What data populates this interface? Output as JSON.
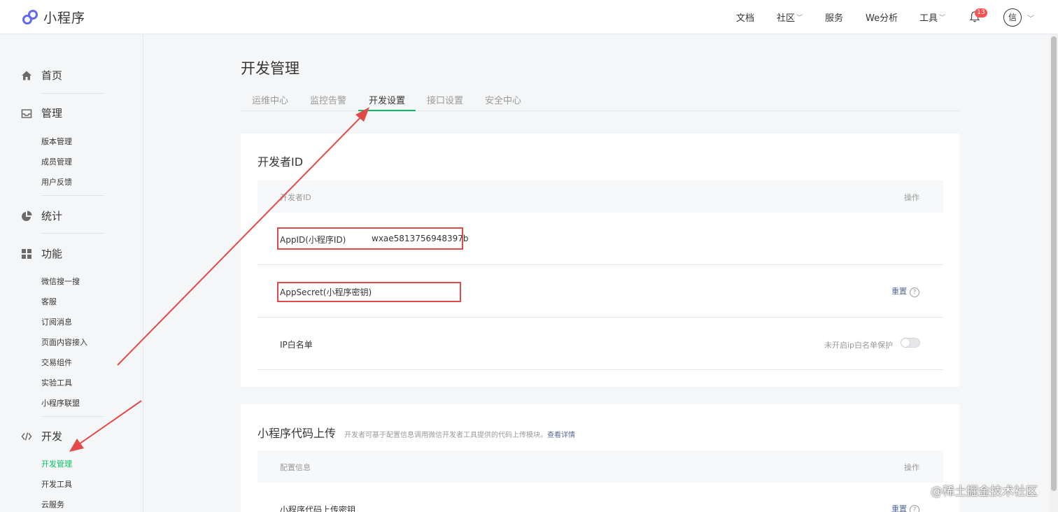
{
  "app": {
    "title": "小程序"
  },
  "topnav": {
    "items": [
      "文档",
      "社区",
      "服务",
      "We分析",
      "工具"
    ],
    "notification_count": "13",
    "avatar_text": "信"
  },
  "sidebar": {
    "sections": [
      {
        "label": "首页",
        "icon": "home-icon"
      },
      {
        "label": "管理",
        "icon": "inbox-icon",
        "items": [
          "版本管理",
          "成员管理",
          "用户反馈"
        ]
      },
      {
        "label": "统计",
        "icon": "pie-chart-icon"
      },
      {
        "label": "功能",
        "icon": "grid-icon",
        "items": [
          "微信搜一搜",
          "客服",
          "订阅消息",
          "页面内容接入",
          "交易组件",
          "实验工具",
          "小程序联盟"
        ]
      },
      {
        "label": "开发",
        "icon": "code-icon",
        "items": [
          "开发管理",
          "开发工具",
          "云服务"
        ]
      }
    ],
    "active_item": "开发管理"
  },
  "main": {
    "title": "开发管理",
    "tabs": [
      "运维中心",
      "监控告警",
      "开发设置",
      "接口设置",
      "安全中心"
    ],
    "active_tab": "开发设置",
    "developer_id": {
      "title": "开发者ID",
      "headers": {
        "col1": "开发者ID",
        "col2": "操作"
      },
      "rows": {
        "appid": {
          "label": "AppID(小程序ID)",
          "value": "wxae5813756948397b"
        },
        "appsecret": {
          "label": "AppSecret(小程序密钥)",
          "action": "重置"
        },
        "ip_whitelist": {
          "label": "IP白名单",
          "status": "未开启ip白名单保护"
        }
      }
    },
    "code_upload": {
      "title": "小程序代码上传",
      "desc": "开发者可基于配置信息调用微信开发者工具提供的代码上传模块。",
      "link": "查看详情",
      "headers": {
        "col1": "配置信息",
        "col2": "操作"
      },
      "row": {
        "label": "小程序代码上传密钥",
        "action": "重置"
      }
    }
  },
  "watermark": "@稀土掘金技术社区",
  "colors": {
    "accent": "#07c160",
    "link": "#576b95",
    "annotation": "#e24a4a"
  }
}
